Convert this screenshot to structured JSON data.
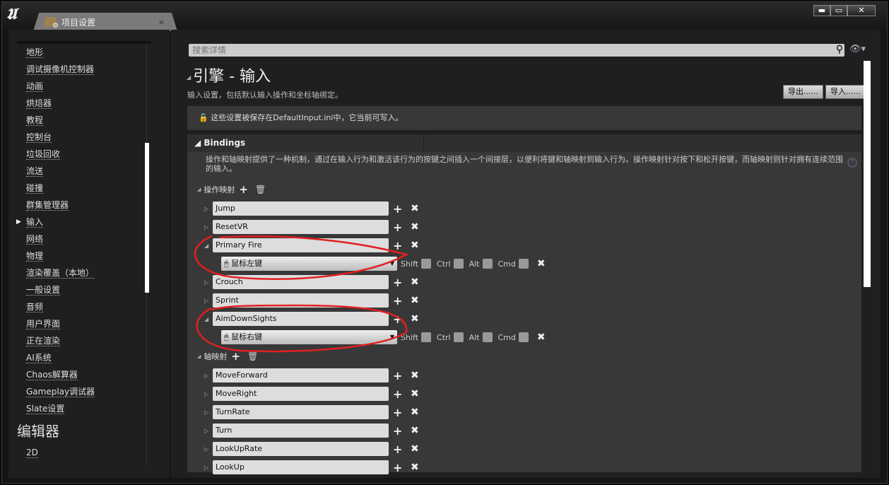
{
  "window": {
    "tab_title": "项目设置",
    "tab_close": "×",
    "min": "▬",
    "max": "▭",
    "close": "✕",
    "logo": "U"
  },
  "sidebar": {
    "items": [
      "地形",
      "调试摄像机控制器",
      "动画",
      "烘焙器",
      "教程",
      "控制台",
      "垃圾回收",
      "流送",
      "碰撞",
      "群集管理器",
      "输入",
      "网络",
      "物理",
      "渲染覆盖（本地）",
      "一般设置",
      "音频",
      "用户界面",
      "正在渲染",
      "AI系统",
      "Chaos解算器",
      "Gameplay调试器",
      "Slate设置"
    ],
    "selected": "输入",
    "section": "编辑器",
    "section_items": [
      "2D"
    ]
  },
  "main": {
    "search_placeholder": "搜索详情",
    "title": "引擎 - 输入",
    "description": "输入设置，包括默认输入操作和坐标轴绑定。",
    "export": "导出......",
    "import": "导入......",
    "info": "这些设置被保存在DefaultInput.ini中，它当前可写入。"
  },
  "bindings": {
    "header": "Bindings",
    "description": "操作和轴映射提供了一种机制，通过在输入行为和激活该行为的按键之间插入一个间接层，以便利将键和轴映射到输入行为。操作映射针对按下和松开按键，而轴映射则针对拥有连续范围的输入。",
    "action_label": "操作映射",
    "axis_label": "轴映射",
    "actions": [
      {
        "name": "Jump"
      },
      {
        "name": "ResetVR"
      },
      {
        "name": "Primary Fire",
        "key": "鼠标左键"
      },
      {
        "name": "Crouch"
      },
      {
        "name": "Sprint"
      },
      {
        "name": "AimDownSights",
        "key": "鼠标右键"
      }
    ],
    "axes": [
      "MoveForward",
      "MoveRight",
      "TurnRate",
      "Turn",
      "LookUpRate",
      "LookUp"
    ],
    "modifiers": [
      "Shift",
      "Ctrl",
      "Alt",
      "Cmd"
    ]
  },
  "annotation_color": "#e02020"
}
